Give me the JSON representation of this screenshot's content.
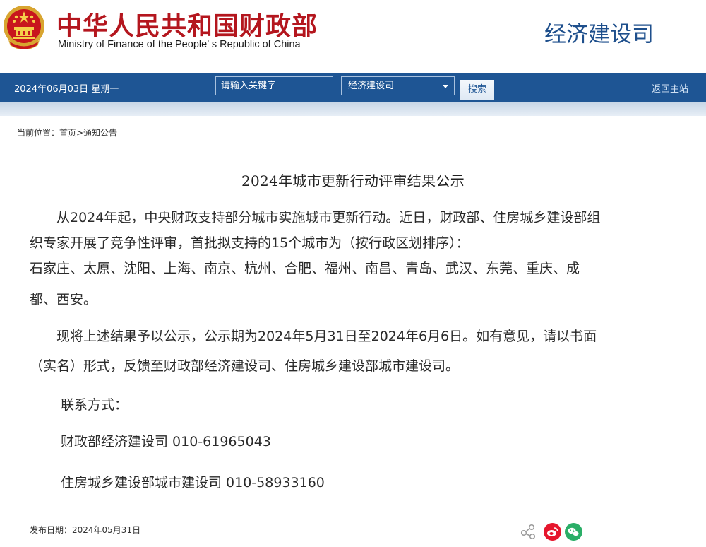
{
  "header": {
    "site_title_cn": "中华人民共和国财政部",
    "site_title_en": "Ministry of Finance of the People’ s Republic of China",
    "dept_name": "经济建设司",
    "emblem_icon": "national-emblem-icon"
  },
  "navbar": {
    "date_text": "2024年06月03日  星期一",
    "search_placeholder": "请输入关键字",
    "select_value": "经济建设司",
    "search_button": "搜索",
    "home_link": "返回主站"
  },
  "breadcrumb": {
    "text": "当前位置：首页>通知公告"
  },
  "article": {
    "title": "2024年城市更新行动评审结果公示",
    "p1_line1": "　　从2024年起，中央财政支持部分城市实施城市更新行动。近日，财政部、住房城乡建设部组",
    "p1_line2": "织专家开展了竞争性评审，首批拟支持的15个城市为（按行政区划排序）：",
    "p1_line3": "石家庄、太原、沈阳、上海、南京、杭州、合肥、福州、南昌、青岛、武汉、东莞、重庆、成",
    "p1_line4": "都、西安。",
    "p2_line1": "　　现将上述结果予以公示，公示期为2024年5月31日至2024年6月6日。如有意见，请以书面",
    "p2_line2": "（实名）形式，反馈至财政部经济建设司、住房城乡建设部城市建设司。",
    "contact_label": "联系方式：",
    "contact1": "财政部经济建设司 010-61965043",
    "contact2": "住房城乡建设部城市建设司 010-58933160"
  },
  "footer": {
    "publish_date": "发布日期：2024年05月31日",
    "share_icon": "share-icon",
    "weibo_icon": "weibo-icon",
    "wechat_icon": "wechat-icon"
  },
  "colors": {
    "brand_red": "#b4161e",
    "nav_blue": "#1e5594",
    "dept_blue": "#1e4f8c",
    "weibo_red": "#e6162d",
    "wechat_green": "#2aae67"
  }
}
